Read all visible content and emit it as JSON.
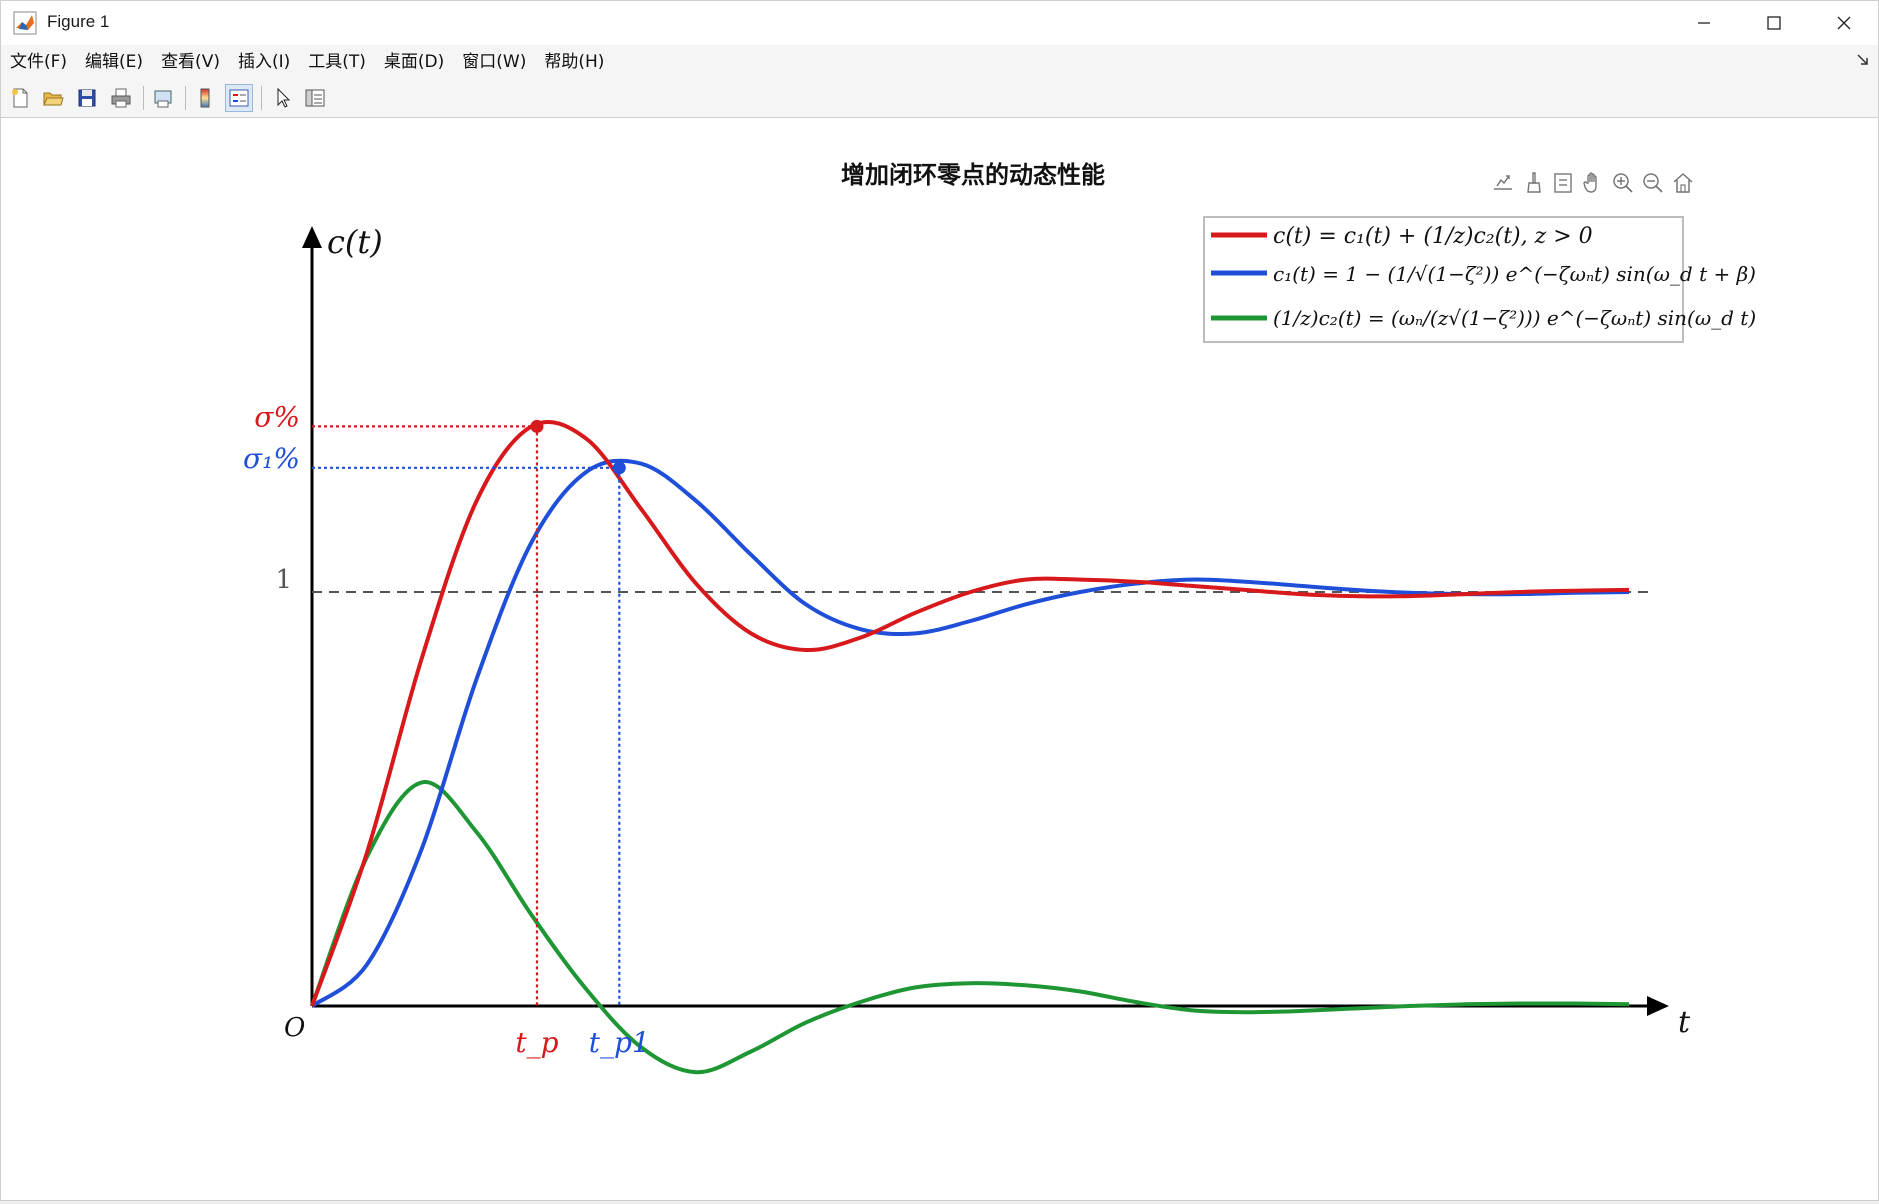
{
  "window": {
    "title": "Figure 1",
    "controls": {
      "minimize": "—",
      "maximize": "☐",
      "close": "✕"
    }
  },
  "menu": {
    "items": [
      "文件(F)",
      "编辑(E)",
      "查看(V)",
      "插入(I)",
      "工具(T)",
      "桌面(D)",
      "窗口(W)",
      "帮助(H)"
    ],
    "undock_icon": "undock-arrow-icon"
  },
  "toolbar": {
    "buttons": [
      "new-figure-icon",
      "open-icon",
      "save-icon",
      "print-icon",
      "print-preview-icon",
      "colorbar-icon",
      "legend-icon",
      "pointer-icon",
      "property-inspector-icon"
    ],
    "pressed": "legend-icon"
  },
  "axes_toolbar": [
    "export-icon",
    "brush-icon",
    "datatip-icon",
    "pan-hand-icon",
    "zoom-in-icon",
    "zoom-out-icon",
    "home-icon"
  ],
  "colors": {
    "red": "#d7191c",
    "blue": "#1f4fd8",
    "green": "#1e9634",
    "ref": "#555555",
    "axis": "#000000"
  },
  "chart_data": {
    "type": "line",
    "title": "增加闭环零点的动态性能",
    "xlabel": "t",
    "ylabel": "c(t)",
    "origin_label": "O",
    "grid": false,
    "legend_position": "top-right",
    "x": [
      0,
      0.5,
      1.0,
      1.5,
      2.0,
      2.5,
      3.0,
      3.5,
      4.0,
      4.5,
      5.0,
      5.5,
      6.0,
      6.5,
      7.0,
      7.5,
      8.0,
      8.5,
      9.0,
      9.5,
      10.0,
      10.5,
      11.0,
      11.5,
      12.0
    ],
    "xlim": [
      0,
      12
    ],
    "ylim": [
      -0.2,
      1.8
    ],
    "series": [
      {
        "name": "c(t) = c₁(t) + (1/z)c₂(t),   z > 0",
        "color": "#d7191c",
        "values": [
          0.0,
          0.37,
          0.84,
          1.22,
          1.4,
          1.37,
          1.2,
          1.02,
          0.9,
          0.86,
          0.89,
          0.95,
          1.0,
          1.03,
          1.03,
          1.025,
          1.015,
          1.005,
          0.995,
          0.99,
          0.99,
          0.995,
          1.0,
          1.003,
          1.005
        ]
      },
      {
        "name": "c₁(t) = 1 − (1/√(1−ζ²)) e^(−ζωₙt) sin(ω_d t + β)",
        "color": "#1f4fd8",
        "values": [
          0.0,
          0.1,
          0.38,
          0.79,
          1.12,
          1.29,
          1.31,
          1.22,
          1.09,
          0.97,
          0.91,
          0.9,
          0.93,
          0.97,
          1.0,
          1.02,
          1.03,
          1.025,
          1.015,
          1.005,
          0.998,
          0.995,
          0.995,
          0.998,
          1.0
        ]
      },
      {
        "name": "(1/z)c₂(t) = (ωₙ/(z√(1−ζ²))) e^(−ζωₙt) sin(ω_d t)",
        "color": "#1e9634",
        "values": [
          0.0,
          0.36,
          0.54,
          0.42,
          0.22,
          0.04,
          -0.1,
          -0.16,
          -0.11,
          -0.04,
          0.01,
          0.045,
          0.055,
          0.05,
          0.035,
          0.01,
          -0.01,
          -0.015,
          -0.012,
          -0.006,
          0.0,
          0.004,
          0.006,
          0.006,
          0.004
        ]
      }
    ],
    "reference_line": {
      "y": 1.0,
      "label": "1",
      "style": "dashed"
    },
    "annotations": [
      {
        "series": "red",
        "peak_t": 2.05,
        "peak_y": 1.4,
        "y_label": "σ%",
        "x_label": "t_p"
      },
      {
        "series": "blue",
        "peak_t": 2.8,
        "peak_y": 1.3,
        "y_label": "σ₁%",
        "x_label": "t_p1"
      }
    ]
  }
}
